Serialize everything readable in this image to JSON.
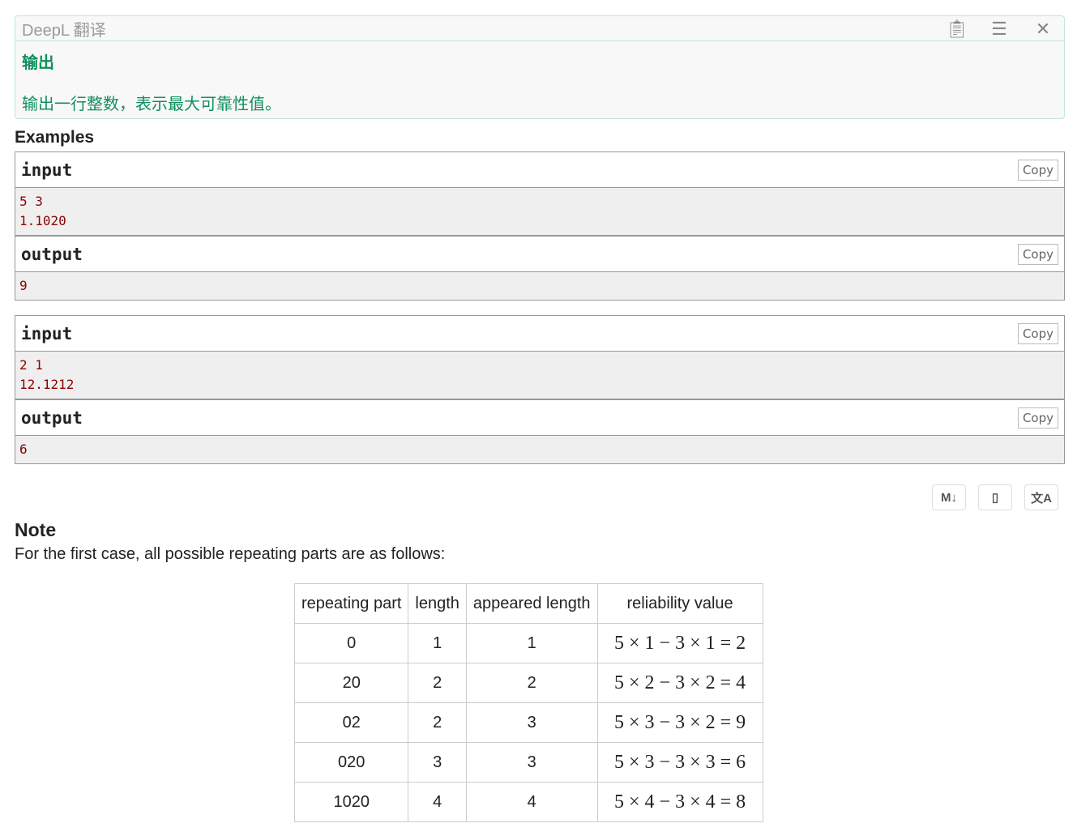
{
  "deepl": {
    "title": "DeepL 翻译",
    "output_title": "输出",
    "output_text": "输出一行整数，表示最大可靠性值。"
  },
  "examples_title": "Examples",
  "examples": [
    {
      "input_label": "input",
      "input_lines": [
        "5 3",
        "1.1020"
      ],
      "output_label": "output",
      "output": "9",
      "copy": "Copy"
    },
    {
      "input_label": "input",
      "input_lines": [
        "2 1",
        "12.1212"
      ],
      "output_label": "output",
      "output": "6",
      "copy": "Copy"
    }
  ],
  "tools": {
    "md": "M↓"
  },
  "note": {
    "title": "Note",
    "text": "For the first case, all possible repeating parts are as follows:"
  },
  "table": {
    "headers": [
      "repeating part",
      "length",
      "appeared length",
      "reliability value"
    ],
    "rows": [
      [
        "0",
        "1",
        "1",
        "5 × 1 − 3 × 1 = 2"
      ],
      [
        "20",
        "2",
        "2",
        "5 × 2 − 3 × 2 = 4"
      ],
      [
        "02",
        "2",
        "3",
        "5 × 3 − 3 × 2 = 9"
      ],
      [
        "020",
        "3",
        "3",
        "5 × 3 − 3 × 3 = 6"
      ],
      [
        "1020",
        "4",
        "4",
        "5 × 4 − 3 × 4 = 8"
      ]
    ]
  }
}
